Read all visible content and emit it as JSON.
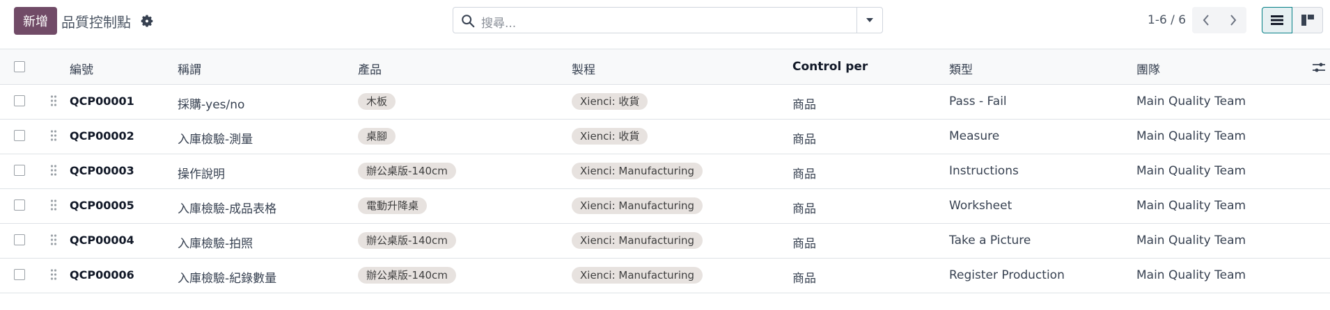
{
  "control_panel": {
    "new_button": "新增",
    "breadcrumb_title": "品質控制點",
    "search_placeholder": "搜尋...",
    "pager_value": "1-6 / 6"
  },
  "table": {
    "headers": {
      "code": "編號",
      "title": "稱謂",
      "product": "產品",
      "operation": "製程",
      "control_per": "Control per",
      "type": "類型",
      "team": "團隊"
    },
    "rows": [
      {
        "code": "QCP00001",
        "title": "採購-yes/no",
        "product": "木板",
        "operation": "Xienci: 收貨",
        "control_per": "商品",
        "type": "Pass - Fail",
        "team": "Main Quality Team"
      },
      {
        "code": "QCP00002",
        "title": "入庫檢驗-測量",
        "product": "桌腳",
        "operation": "Xienci: 收貨",
        "control_per": "商品",
        "type": "Measure",
        "team": "Main Quality Team"
      },
      {
        "code": "QCP00003",
        "title": "操作說明",
        "product": "辦公桌版-140cm",
        "operation": "Xienci: Manufacturing",
        "control_per": "商品",
        "type": "Instructions",
        "team": "Main Quality Team"
      },
      {
        "code": "QCP00005",
        "title": "入庫檢驗-成品表格",
        "product": "電動升降桌",
        "operation": "Xienci: Manufacturing",
        "control_per": "商品",
        "type": "Worksheet",
        "team": "Main Quality Team"
      },
      {
        "code": "QCP00004",
        "title": "入庫檢驗-拍照",
        "product": "辦公桌版-140cm",
        "operation": "Xienci: Manufacturing",
        "control_per": "商品",
        "type": "Take a Picture",
        "team": "Main Quality Team"
      },
      {
        "code": "QCP00006",
        "title": "入庫檢驗-紀錄數量",
        "product": "辦公桌版-140cm",
        "operation": "Xienci: Manufacturing",
        "control_per": "商品",
        "type": "Register Production",
        "team": "Main Quality Team"
      }
    ]
  },
  "colors": {
    "brand": "#714B67",
    "tag_bg": "#e7e2df",
    "active_view": "#017e84"
  },
  "icons": [
    "gear-icon",
    "search-icon",
    "caret-down-icon",
    "chevron-left-icon",
    "chevron-right-icon",
    "list-view-icon",
    "kanban-view-icon",
    "drag-handle-icon",
    "optional-columns-icon"
  ]
}
